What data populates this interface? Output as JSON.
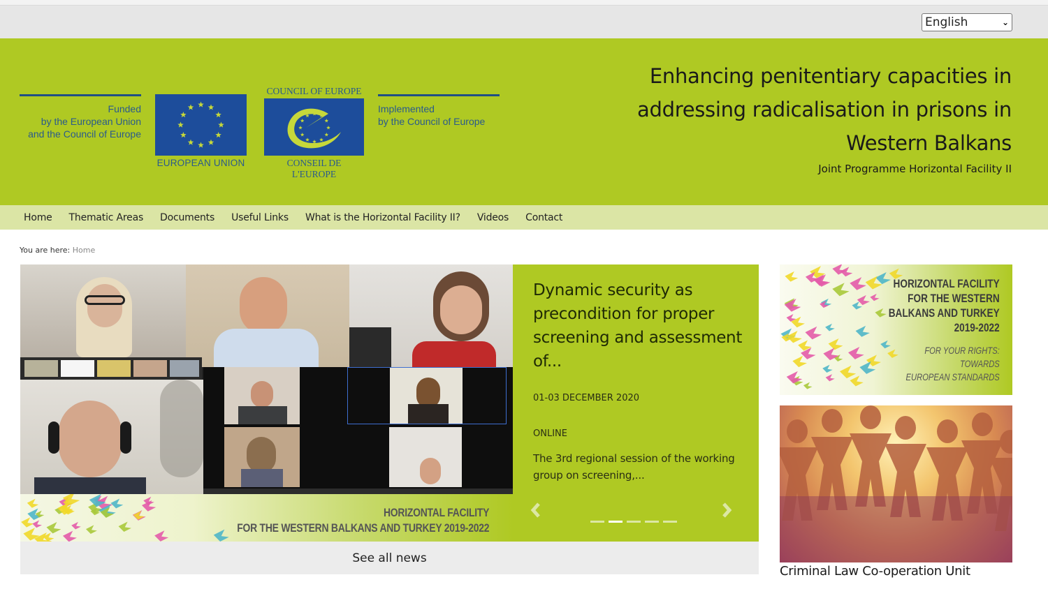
{
  "language_selector": {
    "selected": "English"
  },
  "header": {
    "funded_lines": [
      "Funded",
      "by the European Union",
      "and the Council of Europe"
    ],
    "eu_label": "EUROPEAN UNION",
    "coe_top_label": "COUNCIL OF EUROPE",
    "coe_bottom_label": "CONSEIL DE L'EUROPE",
    "implemented_lines": [
      "Implemented",
      "by the Council of Europe"
    ],
    "title_lines": [
      "Enhancing penitentiary capacities in",
      "addressing radicalisation in prisons in",
      "Western Balkans"
    ],
    "subtitle": "Joint Programme Horizontal Facility II"
  },
  "nav": {
    "items": [
      {
        "label": "Home"
      },
      {
        "label": "Thematic Areas"
      },
      {
        "label": "Documents"
      },
      {
        "label": "Useful Links"
      },
      {
        "label": "What is the Horizontal Facility II?"
      },
      {
        "label": "Videos"
      },
      {
        "label": "Contact"
      }
    ]
  },
  "breadcrumb": {
    "prefix": "You are here:",
    "current": "Home"
  },
  "slider": {
    "banner_lines": [
      "HORIZONTAL FACILITY",
      "FOR THE WESTERN BALKANS AND TURKEY 2019-2022"
    ],
    "slide": {
      "title": "Dynamic security as precondition for proper screening and assessment of...",
      "date": "01-03 DECEMBER 2020",
      "location": "ONLINE",
      "description": "The 3rd regional session of the working group on screening,..."
    },
    "prev_icon": "‹",
    "next_icon": "›",
    "dot_count": 5,
    "active_dot": 2
  },
  "see_all_news": "See all news",
  "sidebar": {
    "banner_title_lines": [
      "HORIZONTAL FACILITY",
      "FOR THE WESTERN",
      "BALKANS AND TURKEY",
      "2019-2022"
    ],
    "banner_sub_lines": [
      "FOR YOUR RIGHTS:",
      "TOWARDS",
      "EUROPEAN STANDARDS"
    ],
    "photo_caption": "Criminal Law Co-operation Unit"
  },
  "colors": {
    "brand_green": "#afc923",
    "nav_green": "#dbe5a5",
    "logo_blue": "#1d4d9b",
    "logo_text_blue": "#2a5a8c"
  }
}
